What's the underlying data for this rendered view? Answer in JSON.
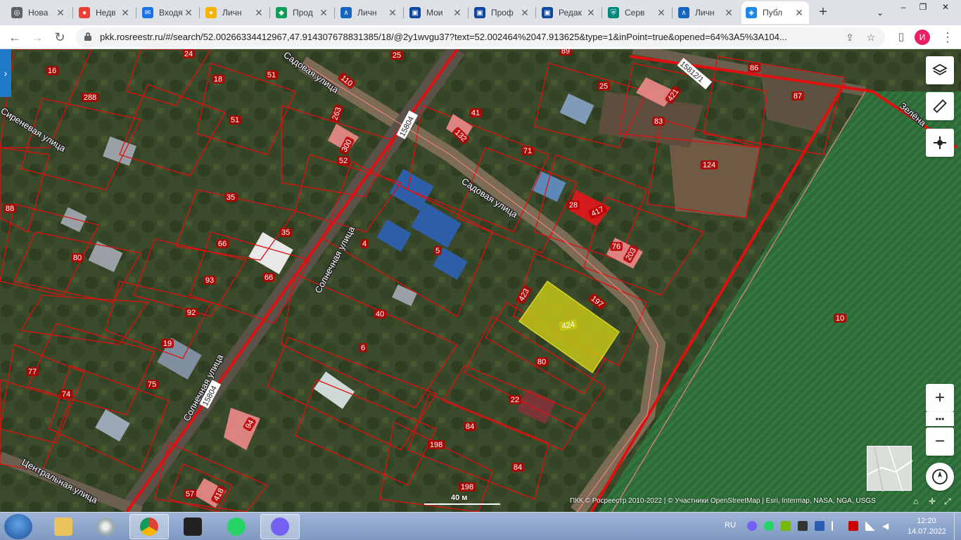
{
  "browser": {
    "tabs": [
      {
        "label": "Нова",
        "color": "#5f6368",
        "glyph": "◎"
      },
      {
        "label": "Недв",
        "color": "#e94235",
        "glyph": "●"
      },
      {
        "label": "Входя",
        "color": "#1a73e8",
        "glyph": "✉"
      },
      {
        "label": "Личн",
        "color": "#f4b400",
        "glyph": "●"
      },
      {
        "label": "Прод",
        "color": "#0f9d58",
        "glyph": "◆"
      },
      {
        "label": "Личн",
        "color": "#1565c0",
        "glyph": "∧"
      },
      {
        "label": "Мои",
        "color": "#0d47a1",
        "glyph": "▣"
      },
      {
        "label": "Проф",
        "color": "#0d47a1",
        "glyph": "▣"
      },
      {
        "label": "Редак",
        "color": "#0d47a1",
        "glyph": "▣"
      },
      {
        "label": "Серв",
        "color": "#00897b",
        "glyph": "⛨"
      },
      {
        "label": "Личн",
        "color": "#1565c0",
        "glyph": "∧"
      },
      {
        "label": "Публ",
        "color": "#1e88e5",
        "glyph": "◈",
        "active": true
      }
    ],
    "url": "pkk.rosreestr.ru/#/search/52.00266334412967,47.914307678831385/18/@2y1wvgu37?text=52.002464%2047.913625&type=1&inPoint=true&opened=64%3A5%3A104...",
    "profile_initial": "И"
  },
  "map": {
    "streets": [
      {
        "text": "Садовая улица"
      },
      {
        "text": "Садовая улица"
      },
      {
        "text": "Солнечная улица"
      },
      {
        "text": "Солнечная улица"
      },
      {
        "text": "Сиреневая улица"
      },
      {
        "text": "Центральная улица"
      },
      {
        "text": "Зелёна"
      }
    ],
    "road_codes": [
      "15804",
      "15804",
      "15812/1"
    ],
    "parcel_numbers": [
      "16",
      "24",
      "25",
      "89",
      "86",
      "288",
      "18",
      "51",
      "110",
      "25",
      "421",
      "87",
      "51",
      "263",
      "41",
      "83",
      "300",
      "132",
      "52",
      "71",
      "124",
      "88",
      "35",
      "28",
      "417",
      "35",
      "66",
      "4",
      "5",
      "76",
      "203",
      "80",
      "93",
      "66",
      "423",
      "197",
      "92",
      "40",
      "424",
      "10",
      "19",
      "6",
      "80",
      "77",
      "74",
      "75",
      "22",
      "94",
      "84",
      "198",
      "84",
      "198",
      "57",
      "418"
    ],
    "highlighted_parcel": "424",
    "scale_label": "40 м",
    "attribution": "ПКК © Росреестр 2010-2022 | © Участники OpenStreetMap | Esri, Intermap, NASA, NGA, USGS",
    "controls": {
      "zoom_in": "+",
      "more": "•••",
      "zoom_out": "−"
    }
  },
  "taskbar": {
    "lang": "RU",
    "time": "12:20",
    "date": "14.07.2022"
  }
}
